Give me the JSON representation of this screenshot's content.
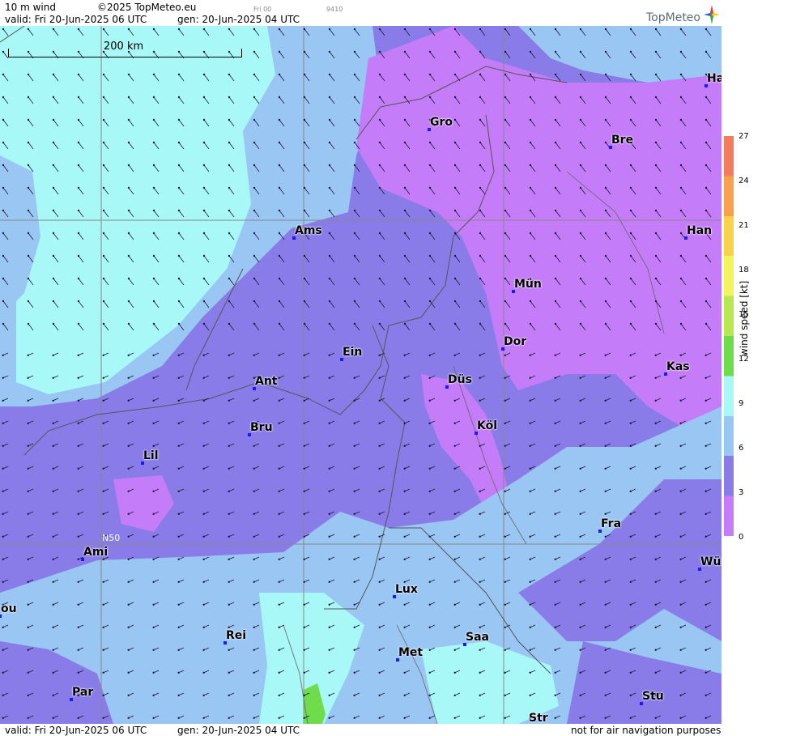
{
  "header": {
    "product": "10 m wind",
    "copyright": "©2025 TopMeteo.eu",
    "valid": "valid:  Fri  20-Jun-2025  06 UTC",
    "gen": "gen: 20-Jun-2025 04 UTC",
    "small_day": "Fri 00",
    "small_code": "9410"
  },
  "logo": {
    "text": "TopMeteo"
  },
  "scale": {
    "label": "200 km"
  },
  "grid_label": "N50",
  "cities": [
    {
      "id": "ha",
      "label": "Ha"
    },
    {
      "id": "gro",
      "label": "Gro"
    },
    {
      "id": "bre",
      "label": "Bre"
    },
    {
      "id": "ams",
      "label": "Ams"
    },
    {
      "id": "han",
      "label": "Han"
    },
    {
      "id": "mun",
      "label": "Mün"
    },
    {
      "id": "dor",
      "label": "Dor"
    },
    {
      "id": "ein",
      "label": "Ein"
    },
    {
      "id": "kas",
      "label": "Kas"
    },
    {
      "id": "ant",
      "label": "Ant"
    },
    {
      "id": "dus",
      "label": "Düs"
    },
    {
      "id": "bru",
      "label": "Bru"
    },
    {
      "id": "kol",
      "label": "Köl"
    },
    {
      "id": "lil",
      "label": "Lil"
    },
    {
      "id": "fra",
      "label": "Fra"
    },
    {
      "id": "ami",
      "label": "Ami"
    },
    {
      "id": "wu",
      "label": "Wü"
    },
    {
      "id": "lux",
      "label": "Lux"
    },
    {
      "id": "ou",
      "label": "ou"
    },
    {
      "id": "rei",
      "label": "Rei"
    },
    {
      "id": "saa",
      "label": "Saa"
    },
    {
      "id": "met",
      "label": "Met"
    },
    {
      "id": "par",
      "label": "Par"
    },
    {
      "id": "stu",
      "label": "Stu"
    },
    {
      "id": "str",
      "label": "Str"
    }
  ],
  "legend": {
    "title": "wind speed [kt]",
    "ticks": [
      "27",
      "24",
      "21",
      "18",
      "15",
      "12",
      "9",
      "6",
      "3",
      "0"
    ],
    "colors": [
      "#f47c5c",
      "#f7a24a",
      "#f8d24a",
      "#f3f35a",
      "#b8e84f",
      "#6fdc4c",
      "#a8f8f8",
      "#9ac6f4",
      "#8a7ce8",
      "#c47cf8"
    ]
  },
  "footer": {
    "valid": "valid:  Fri  20-Jun-2025  06 UTC",
    "gen": "gen: 20-Jun-2025 04 UTC",
    "disclaimer": "not for air navigation purposes"
  }
}
